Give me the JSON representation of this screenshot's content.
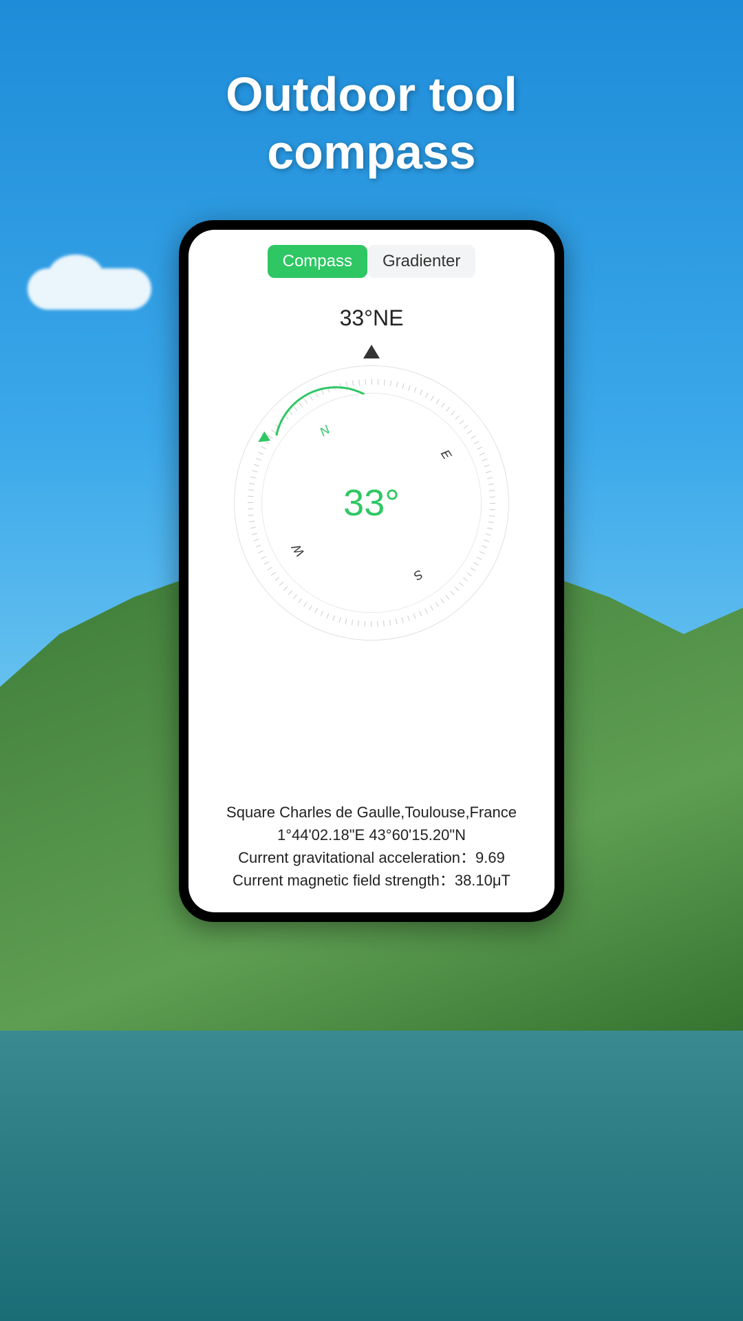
{
  "headline": {
    "line1": "Outdoor tool",
    "line2": "compass"
  },
  "tabs": {
    "compass": "Compass",
    "gradienter": "Gradienter"
  },
  "compass": {
    "heading_reading": "33°NE",
    "degree_display": "33°",
    "rotation_deg": -33,
    "cardinals": {
      "n": "N",
      "e": "E",
      "s": "S",
      "w": "W"
    }
  },
  "colors": {
    "accent_green": "#2ec763"
  },
  "info": {
    "location": "Square Charles de Gaulle,Toulouse,France",
    "coordinates": "1°44'02.18\"E  43°60'15.20\"N",
    "gravity_label": "Current gravitational acceleration：",
    "gravity_value": "9.69",
    "magnetic_label": "Current magnetic field strength：",
    "magnetic_value": "38.10μT"
  }
}
